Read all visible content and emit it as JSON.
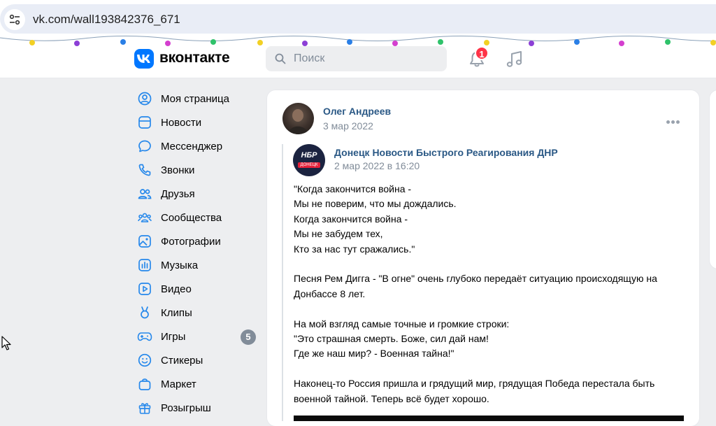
{
  "browser": {
    "url": "vk.com/wall193842376_671"
  },
  "header": {
    "logo_text": "вконтакте",
    "search_placeholder": "Поиск",
    "notifications_count": "1"
  },
  "sidebar": {
    "items": [
      {
        "label": "Моя страница",
        "icon": "user-circle-icon"
      },
      {
        "label": "Новости",
        "icon": "news-icon"
      },
      {
        "label": "Мессенджер",
        "icon": "message-icon"
      },
      {
        "label": "Звонки",
        "icon": "phone-icon"
      },
      {
        "label": "Друзья",
        "icon": "friends-icon"
      },
      {
        "label": "Сообщества",
        "icon": "communities-icon"
      },
      {
        "label": "Фотографии",
        "icon": "photo-icon"
      },
      {
        "label": "Музыка",
        "icon": "music-icon"
      },
      {
        "label": "Видео",
        "icon": "video-icon"
      },
      {
        "label": "Клипы",
        "icon": "clips-icon"
      },
      {
        "label": "Игры",
        "icon": "gamepad-icon",
        "badge": "5"
      },
      {
        "label": "Стикеры",
        "icon": "smile-icon"
      },
      {
        "label": "Маркет",
        "icon": "bag-icon"
      },
      {
        "label": "Розыгрыш",
        "icon": "gift-icon"
      }
    ]
  },
  "post": {
    "author": "Олег Андреев",
    "date": "3 мар 2022",
    "repost": {
      "source_name": "Донецк Новости Быстрого Реагирования ДНР",
      "source_date": "2 мар 2022 в 16:20",
      "avatar_text": "НБР",
      "avatar_subtext": "ДОНЕЦК"
    },
    "text_lines": [
      "\"Когда закончится война -",
      "Мы не поверим, что мы дождались.",
      "Когда закончится война -",
      "Мы не забудем тех,",
      "Кто за нас тут сражались.\"",
      "",
      "Песня Рем Дигга - \"В огне\" очень глубоко передаёт ситуацию происходящую на",
      "Донбассе 8 лет.",
      "",
      "На мой взгляд самые точные и громкие строки:",
      "\"Это страшная смерть. Боже, сил дай нам!",
      "Где же наш мир? - Военная тайна!\"",
      "",
      "Наконец-то Россия пришла и грядущий мир, грядущая Победа перестала быть",
      "военной тайной. Теперь всё будет хорошо."
    ]
  },
  "colors": {
    "accent": "#0077ff",
    "link": "#2a5885",
    "badge_red": "#ff3347",
    "icon_blue": "#2688eb"
  }
}
